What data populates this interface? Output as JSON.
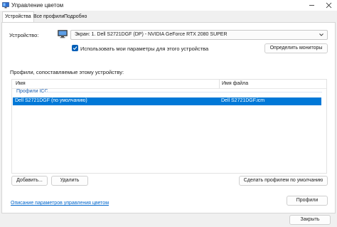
{
  "window": {
    "title": "Управление цветом",
    "close_label": "Закрыть"
  },
  "tabs": [
    {
      "label": "Устройства",
      "active": true
    },
    {
      "label": "Все профили",
      "active": false
    },
    {
      "label": "Подробно",
      "active": false
    }
  ],
  "device": {
    "label": "Устройство:",
    "selected": "Экран: 1. Dell S2721DGF (DP) - NVIDIA GeForce RTX 2080 SUPER",
    "use_settings_label": "Использовать мои параметры для этого устройства",
    "use_settings_checked": true,
    "identify_button": "Определить мониторы"
  },
  "profiles": {
    "heading": "Профили, сопоставляемые этому устройству:",
    "columns": [
      "Имя",
      "Имя файла"
    ],
    "group_label": "Профили ICC",
    "rows": [
      {
        "name": "Dell S2721DGF (по умолчанию)",
        "file": "Dell S2721DGF.icm",
        "selected": true
      }
    ]
  },
  "actions": {
    "add": "Добавить...",
    "remove": "Удалить",
    "set_default": "Сделать профилем по умолчанию"
  },
  "footer": {
    "link": "Описание параметров управления цветом",
    "profiles_button": "Профили"
  },
  "colors": {
    "accent": "#005fb8",
    "selection": "#0078d7",
    "link": "#0066cc"
  }
}
